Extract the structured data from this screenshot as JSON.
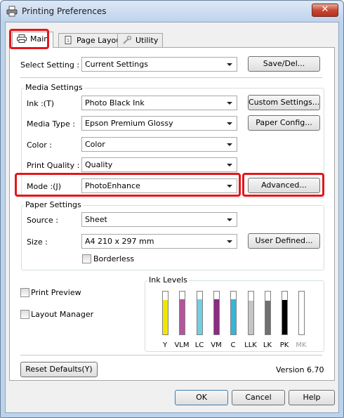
{
  "window": {
    "title": "Printing Preferences",
    "close_glyph": "✕"
  },
  "tabs": [
    {
      "label": "Main",
      "icon": "printer-icon",
      "active": true
    },
    {
      "label": "Page Layout",
      "icon": "page-icon",
      "active": false
    },
    {
      "label": "Utility",
      "icon": "wrench-icon",
      "active": false
    }
  ],
  "select_setting": {
    "label": "Select Setting :",
    "value": "Current Settings",
    "button": "Save/Del..."
  },
  "media_settings": {
    "title": "Media Settings",
    "ink_label": "Ink :(T)",
    "ink_value": "Photo Black Ink",
    "custom_button": "Custom Settings...",
    "media_type_label": "Media Type :",
    "media_type_value": "Epson Premium Glossy",
    "paper_config_button": "Paper Config...",
    "color_label": "Color :",
    "color_value": "Color",
    "quality_label": "Print Quality :",
    "quality_value": "Quality",
    "mode_label": "Mode :(J)",
    "mode_value": "PhotoEnhance",
    "advanced_button": "Advanced..."
  },
  "paper_settings": {
    "title": "Paper Settings",
    "source_label": "Source :",
    "source_value": "Sheet",
    "size_label": "Size :",
    "size_value": "A4 210 x 297 mm",
    "user_defined_button": "User Defined...",
    "borderless_label": "Borderless"
  },
  "options": {
    "print_preview": "Print Preview",
    "layout_manager": "Layout Manager"
  },
  "ink_levels": {
    "title": "Ink Levels",
    "inks": [
      {
        "code": "Y",
        "color": "#f2e600",
        "level": 0.8
      },
      {
        "code": "VLM",
        "color": "#b3559b",
        "level": 0.82
      },
      {
        "code": "LC",
        "color": "#74cde0",
        "level": 0.82
      },
      {
        "code": "VM",
        "color": "#8b2c7f",
        "level": 0.82
      },
      {
        "code": "C",
        "color": "#33b7d8",
        "level": 0.82
      },
      {
        "code": "LLK",
        "color": "#c5c5c5",
        "level": 0.78
      },
      {
        "code": "LK",
        "color": "#707070",
        "level": 0.78
      },
      {
        "code": "PK",
        "color": "#000000",
        "level": 0.8
      },
      {
        "code": "MK",
        "color": "#e8e8e8",
        "level": 0.0
      }
    ]
  },
  "footer": {
    "reset_button": "Reset Defaults(Y)",
    "version": "Version 6.70"
  },
  "dialog_buttons": {
    "ok": "OK",
    "cancel": "Cancel",
    "help": "Help"
  },
  "colors": {
    "highlight": "#e3161b",
    "titlebar": "#bfd3ec"
  }
}
